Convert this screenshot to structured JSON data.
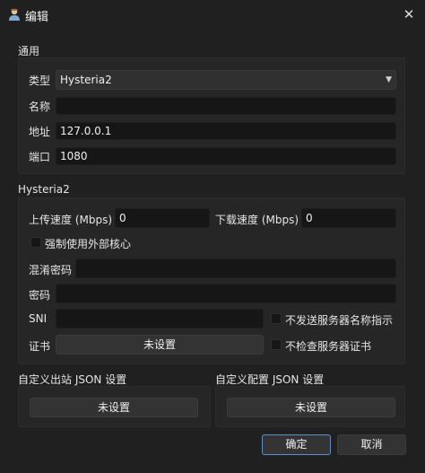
{
  "window": {
    "title": "编辑",
    "icon": "app-icon",
    "close_icon": "close-icon"
  },
  "general": {
    "group_title": "通用",
    "type": {
      "label": "类型",
      "value": "Hysteria2"
    },
    "name": {
      "label": "名称",
      "value": ""
    },
    "address": {
      "label": "地址",
      "value": "127.0.0.1"
    },
    "port": {
      "label": "端口",
      "value": "1080"
    }
  },
  "hysteria2": {
    "group_title": "Hysteria2",
    "upload": {
      "label": "上传速度 (Mbps)",
      "value": "0"
    },
    "download": {
      "label": "下载速度 (Mbps)",
      "value": "0"
    },
    "force_external_core": {
      "label": "强制使用外部核心",
      "checked": false
    },
    "obfs_password": {
      "label": "混淆密码",
      "value": ""
    },
    "password": {
      "label": "密码",
      "value": ""
    },
    "sni": {
      "label": "SNI",
      "value": ""
    },
    "no_sni": {
      "label": "不发送服务器名称指示",
      "checked": false
    },
    "cert": {
      "label": "证书",
      "button": "未设置"
    },
    "skip_cert_check": {
      "label": "不检查服务器证书",
      "checked": false
    }
  },
  "outbound_json": {
    "group_title": "自定义出站 JSON 设置",
    "button": "未设置"
  },
  "config_json": {
    "group_title": "自定义配置 JSON 设置",
    "button": "未设置"
  },
  "footer": {
    "ok": "确定",
    "cancel": "取消"
  }
}
